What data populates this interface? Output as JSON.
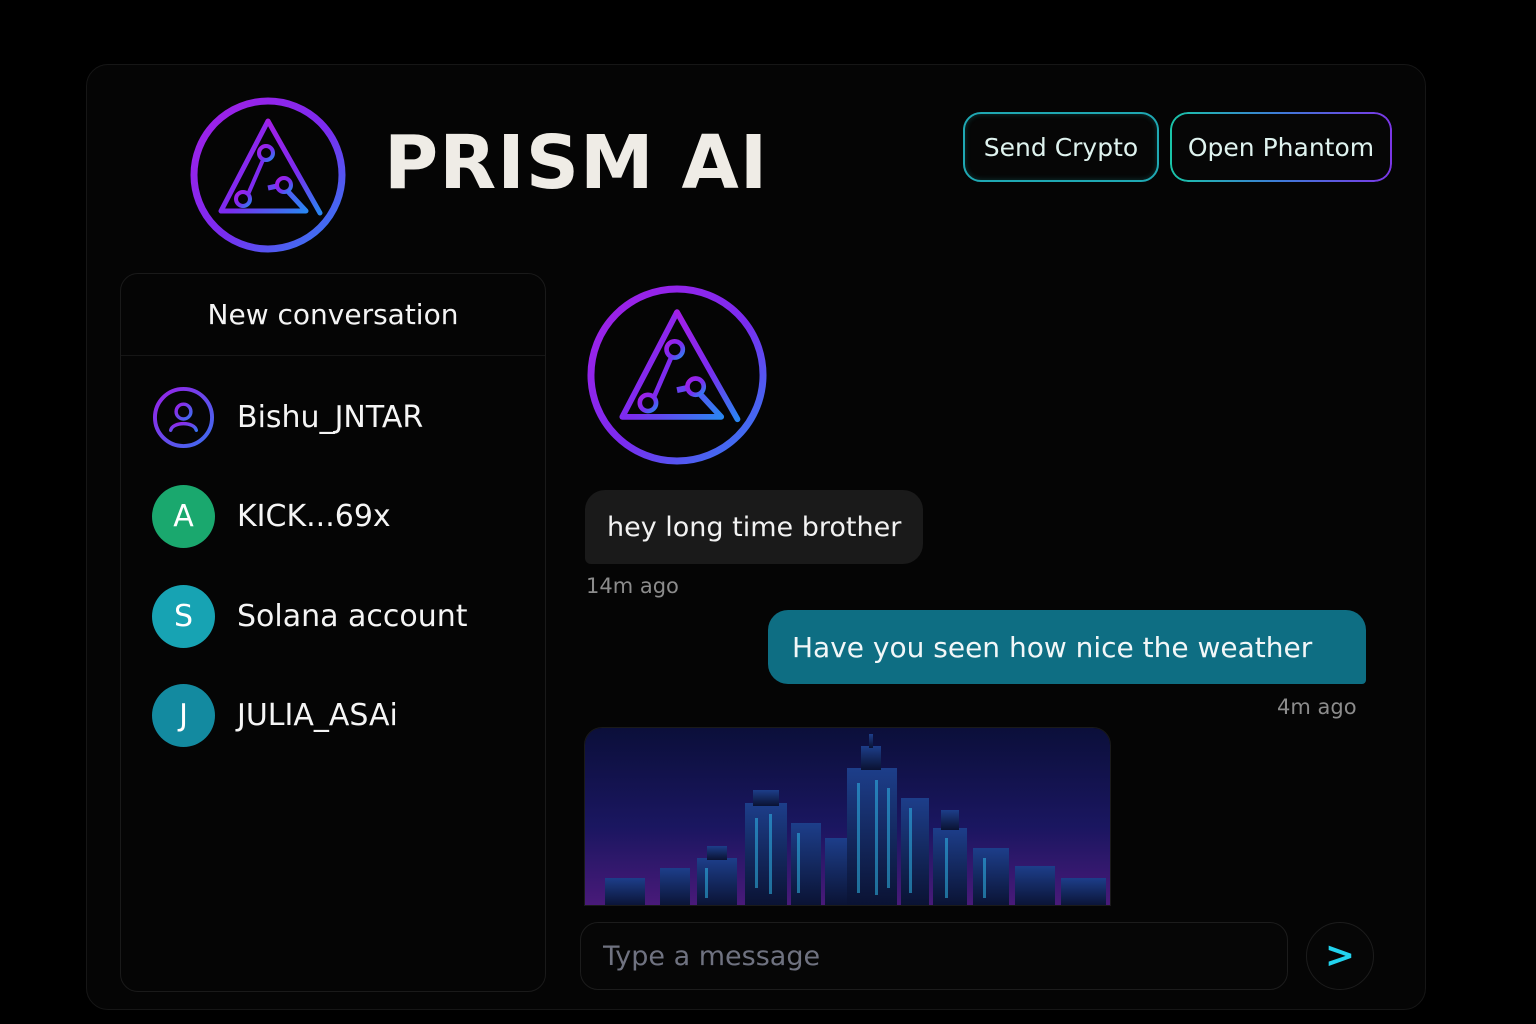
{
  "header": {
    "app_title": "PRISM AI",
    "logo_icon": "prism-triangle-logo-icon",
    "buttons": {
      "send_crypto": "Send Crypto",
      "open_phantom": "Open Phantom"
    }
  },
  "sidebar": {
    "new_conversation_label": "New conversation",
    "contacts": [
      {
        "name": "Bishu_JNTAR",
        "avatar_icon": "user-icon",
        "avatar_letter": ""
      },
      {
        "name": "KICK...69x",
        "avatar_letter": "A",
        "avatar_color": "#1aa86e"
      },
      {
        "name": "Solana account",
        "avatar_letter": "S",
        "avatar_color": "#17a3b3"
      },
      {
        "name": "JULIA_ASAi",
        "avatar_letter": "J",
        "avatar_color": "#138aa0"
      }
    ]
  },
  "chat": {
    "bot_avatar_icon": "prism-triangle-logo-icon",
    "messages": [
      {
        "direction": "incoming",
        "text": "hey long time brother",
        "time": "14m ago"
      },
      {
        "direction": "outgoing",
        "text": "Have you seen how nice the weather",
        "time": "4m ago"
      },
      {
        "direction": "incoming",
        "type": "image",
        "image_icon": "city-skyline-image"
      }
    ],
    "composer": {
      "placeholder": "Type a message",
      "value": "",
      "send_icon": "send-arrow-icon",
      "send_glyph": ">"
    }
  },
  "colors": {
    "accent_purple": "#8a1fe6",
    "accent_blue": "#2f7ff0",
    "accent_teal": "#1fb5b0",
    "outgoing_bubble": "#0e6e83",
    "incoming_bubble": "#1a1a1a"
  }
}
